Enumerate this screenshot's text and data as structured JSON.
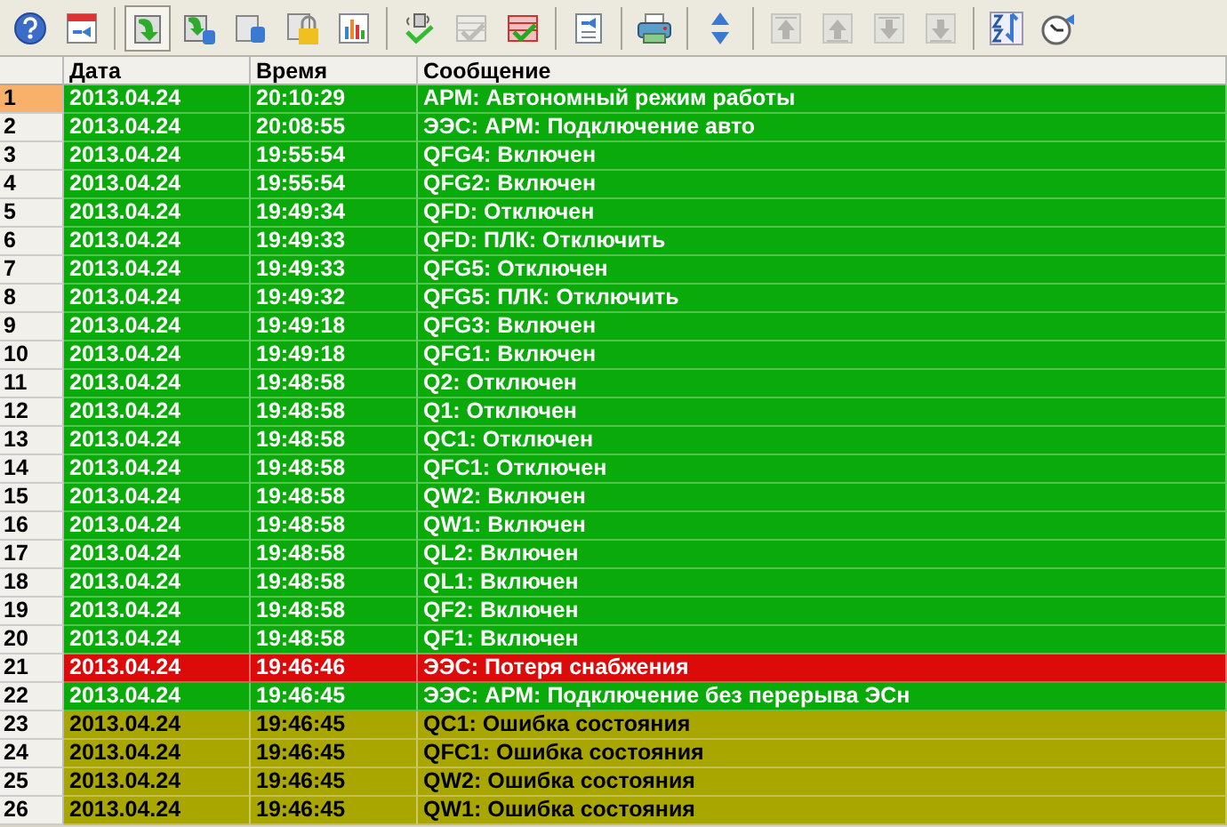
{
  "toolbar": [
    {
      "selected": false,
      "disabled": false
    },
    {
      "selected": false,
      "disabled": false
    },
    {
      "selected": true,
      "disabled": false
    },
    {
      "selected": false,
      "disabled": false
    },
    {
      "selected": false,
      "disabled": false
    },
    {
      "selected": false,
      "disabled": false
    },
    {
      "selected": false,
      "disabled": false
    },
    {
      "selected": false,
      "disabled": false
    },
    {
      "selected": false,
      "disabled": true
    },
    {
      "selected": false,
      "disabled": false
    },
    {
      "selected": false,
      "disabled": false
    },
    {
      "selected": false,
      "disabled": false
    },
    {
      "selected": false,
      "disabled": false
    },
    {
      "selected": false,
      "disabled": true
    },
    {
      "selected": false,
      "disabled": true
    },
    {
      "selected": false,
      "disabled": true
    },
    {
      "selected": false,
      "disabled": true
    },
    {
      "selected": false,
      "disabled": false
    },
    {
      "selected": false,
      "disabled": false
    }
  ],
  "table": {
    "columns": [
      "Дата",
      "Время",
      "Сообщение"
    ],
    "rows": [
      {
        "n": "1",
        "selected": true,
        "color": "#0aaa0a",
        "date": "2013.04.24",
        "time": "20:10:29",
        "message": "АРМ: Автономный режим работы"
      },
      {
        "n": "2",
        "selected": false,
        "color": "#0aaa0a",
        "date": "2013.04.24",
        "time": "20:08:55",
        "message": "ЭЭС: АРМ: Подключение авто"
      },
      {
        "n": "3",
        "selected": false,
        "color": "#0aaa0a",
        "date": "2013.04.24",
        "time": "19:55:54",
        "message": "QFG4: Включен"
      },
      {
        "n": "4",
        "selected": false,
        "color": "#0aaa0a",
        "date": "2013.04.24",
        "time": "19:55:54",
        "message": "QFG2: Включен"
      },
      {
        "n": "5",
        "selected": false,
        "color": "#0aaa0a",
        "date": "2013.04.24",
        "time": "19:49:34",
        "message": "QFD: Отключен"
      },
      {
        "n": "6",
        "selected": false,
        "color": "#0aaa0a",
        "date": "2013.04.24",
        "time": "19:49:33",
        "message": "QFD: ПЛК: Отключить"
      },
      {
        "n": "7",
        "selected": false,
        "color": "#0aaa0a",
        "date": "2013.04.24",
        "time": "19:49:33",
        "message": "QFG5: Отключен"
      },
      {
        "n": "8",
        "selected": false,
        "color": "#0aaa0a",
        "date": "2013.04.24",
        "time": "19:49:32",
        "message": "QFG5: ПЛК: Отключить"
      },
      {
        "n": "9",
        "selected": false,
        "color": "#0aaa0a",
        "date": "2013.04.24",
        "time": "19:49:18",
        "message": "QFG3: Включен"
      },
      {
        "n": "10",
        "selected": false,
        "color": "#0aaa0a",
        "date": "2013.04.24",
        "time": "19:49:18",
        "message": "QFG1: Включен"
      },
      {
        "n": "11",
        "selected": false,
        "color": "#0aaa0a",
        "date": "2013.04.24",
        "time": "19:48:58",
        "message": "Q2: Отключен"
      },
      {
        "n": "12",
        "selected": false,
        "color": "#0aaa0a",
        "date": "2013.04.24",
        "time": "19:48:58",
        "message": "Q1: Отключен"
      },
      {
        "n": "13",
        "selected": false,
        "color": "#0aaa0a",
        "date": "2013.04.24",
        "time": "19:48:58",
        "message": "QC1: Отключен"
      },
      {
        "n": "14",
        "selected": false,
        "color": "#0aaa0a",
        "date": "2013.04.24",
        "time": "19:48:58",
        "message": "QFC1: Отключен"
      },
      {
        "n": "15",
        "selected": false,
        "color": "#0aaa0a",
        "date": "2013.04.24",
        "time": "19:48:58",
        "message": "QW2: Включен"
      },
      {
        "n": "16",
        "selected": false,
        "color": "#0aaa0a",
        "date": "2013.04.24",
        "time": "19:48:58",
        "message": "QW1: Включен"
      },
      {
        "n": "17",
        "selected": false,
        "color": "#0aaa0a",
        "date": "2013.04.24",
        "time": "19:48:58",
        "message": "QL2: Включен"
      },
      {
        "n": "18",
        "selected": false,
        "color": "#0aaa0a",
        "date": "2013.04.24",
        "time": "19:48:58",
        "message": "QL1: Включен"
      },
      {
        "n": "19",
        "selected": false,
        "color": "#0aaa0a",
        "date": "2013.04.24",
        "time": "19:48:58",
        "message": "QF2: Включен"
      },
      {
        "n": "20",
        "selected": false,
        "color": "#0aaa0a",
        "date": "2013.04.24",
        "time": "19:48:58",
        "message": "QF1: Включен"
      },
      {
        "n": "21",
        "selected": false,
        "color": "#dd0a0a",
        "date": "2013.04.24",
        "time": "19:46:46",
        "message": "ЭЭС: Потеря снабжения"
      },
      {
        "n": "22",
        "selected": false,
        "color": "#0aaa0a",
        "date": "2013.04.24",
        "time": "19:46:45",
        "message": "ЭЭС: АРМ: Подключение без перерыва ЭСн"
      },
      {
        "n": "23",
        "selected": false,
        "color": "#aaa600",
        "date": "2013.04.24",
        "time": "19:46:45",
        "message": "QC1: Ошибка состояния"
      },
      {
        "n": "24",
        "selected": false,
        "color": "#aaa600",
        "date": "2013.04.24",
        "time": "19:46:45",
        "message": "QFC1: Ошибка состояния"
      },
      {
        "n": "25",
        "selected": false,
        "color": "#aaa600",
        "date": "2013.04.24",
        "time": "19:46:45",
        "message": "QW2: Ошибка состояния"
      },
      {
        "n": "26",
        "selected": false,
        "color": "#aaa600",
        "date": "2013.04.24",
        "time": "19:46:45",
        "message": "QW1: Ошибка состояния"
      }
    ]
  }
}
